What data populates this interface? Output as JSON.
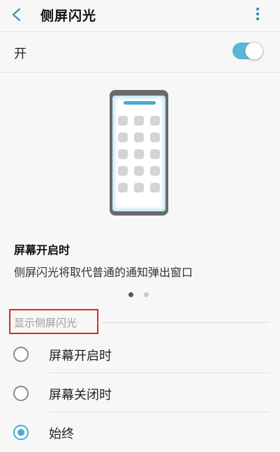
{
  "header": {
    "title": "侧屏闪光",
    "back_icon": "back-chevron-icon",
    "more_icon": "more-vertical-icon"
  },
  "toggle": {
    "label": "开",
    "on": true,
    "accent": "#58b6d8"
  },
  "preview": {
    "title": "屏幕开启时",
    "description": "侧屏闪光将取代普通的通知弹出窗口",
    "page_count": 2,
    "current_page": 1
  },
  "section": {
    "label": "显示侧屏闪光"
  },
  "options": [
    {
      "label": "屏幕开启时",
      "selected": false
    },
    {
      "label": "屏幕关闭时",
      "selected": false
    },
    {
      "label": "始终",
      "selected": true
    }
  ],
  "colors": {
    "accent": "#4aa9d0",
    "highlight_box": "#d8282a"
  }
}
